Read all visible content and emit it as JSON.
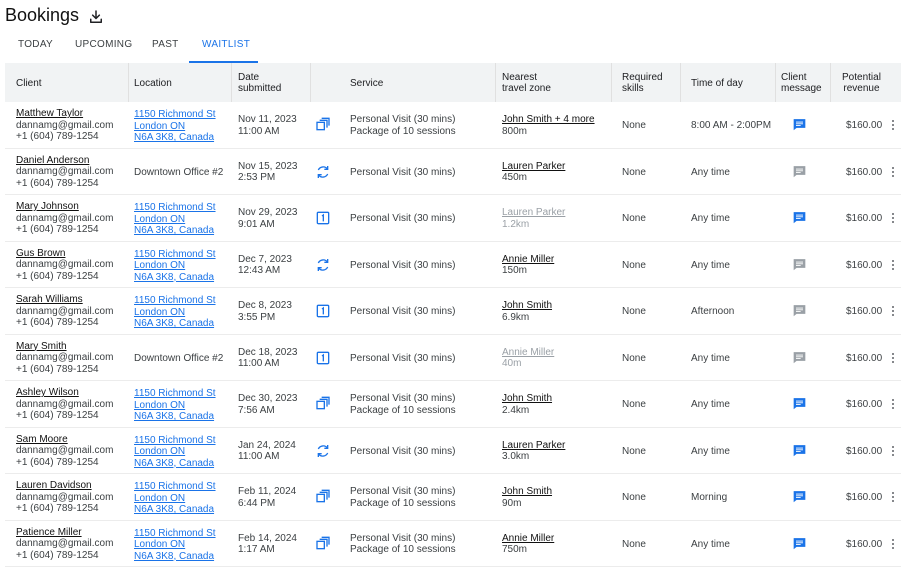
{
  "page": {
    "title": "Bookings",
    "download_icon": "download-icon"
  },
  "tabs": [
    {
      "label": "TODAY",
      "active": false
    },
    {
      "label": "UPCOMING",
      "active": false
    },
    {
      "label": "PAST",
      "active": false
    },
    {
      "label": "WAITLIST",
      "active": true
    }
  ],
  "columns": {
    "client": "Client",
    "location": "Location",
    "date1": "Date",
    "date2": "submitted",
    "service": "Service",
    "zone1": "Nearest",
    "zone2": "travel zone",
    "skills1": "Required",
    "skills2": "skills",
    "time": "Time of day",
    "msg1": "Client",
    "msg2": "message",
    "rev1": "Potential",
    "rev2": "revenue"
  },
  "colors": {
    "accent": "#1a73e8",
    "muted_icon": "#9aa0a6"
  },
  "rows": [
    {
      "name": "Matthew Taylor",
      "email": "dannamg@gmail.com",
      "phone": "+1 (604) 789-1254",
      "location": [
        "1150 Richmond St",
        "London ON",
        "N6A 3K8, Canada"
      ],
      "location_is_link": true,
      "date": "Nov 11, 2023",
      "time": "11:00 AM",
      "service_icon": "package-icon",
      "service": [
        "Personal Visit (30 mins)",
        "Package of 10 sessions"
      ],
      "zone_name": "John Smith + 4 more",
      "zone_dist": "800m",
      "zone_dim": false,
      "skills": "None",
      "time_of_day": "8:00 AM - 2:00PM",
      "message_active": true,
      "revenue": "$160.00"
    },
    {
      "name": "Daniel Anderson",
      "email": "dannamg@gmail.com",
      "phone": "+1 (604) 789-1254",
      "location": [
        "Downtown Office #2"
      ],
      "location_is_link": false,
      "date": "Nov 15, 2023",
      "time": "2:53 PM",
      "service_icon": "recurring-icon",
      "service": [
        "Personal Visit (30 mins)"
      ],
      "zone_name": "Lauren Parker",
      "zone_dist": "450m",
      "zone_dim": false,
      "skills": "None",
      "time_of_day": "Any time",
      "message_active": false,
      "revenue": "$160.00"
    },
    {
      "name": "Mary Johnson",
      "email": "dannamg@gmail.com",
      "phone": "+1 (604) 789-1254",
      "location": [
        "1150 Richmond St",
        "London ON",
        "N6A 3K8, Canada"
      ],
      "location_is_link": true,
      "date": "Nov 29, 2023",
      "time": "9:01 AM",
      "service_icon": "single-session-icon",
      "service": [
        "Personal Visit (30 mins)"
      ],
      "zone_name": "Lauren Parker",
      "zone_dist": "1.2km",
      "zone_dim": true,
      "skills": "None",
      "time_of_day": "Any time",
      "message_active": true,
      "revenue": "$160.00"
    },
    {
      "name": "Gus Brown",
      "email": "dannamg@gmail.com",
      "phone": "+1 (604) 789-1254",
      "location": [
        "1150 Richmond St",
        "London ON",
        "N6A 3K8, Canada"
      ],
      "location_is_link": true,
      "date": "Dec 7, 2023",
      "time": "12:43 AM",
      "service_icon": "recurring-icon",
      "service": [
        "Personal Visit (30 mins)"
      ],
      "zone_name": "Annie Miller",
      "zone_dist": "150m",
      "zone_dim": false,
      "skills": "None",
      "time_of_day": "Any time",
      "message_active": false,
      "revenue": "$160.00"
    },
    {
      "name": "Sarah Williams",
      "email": "dannamg@gmail.com",
      "phone": "+1 (604) 789-1254",
      "location": [
        "1150 Richmond St",
        "London ON",
        "N6A 3K8, Canada"
      ],
      "location_is_link": true,
      "date": "Dec 8, 2023",
      "time": "3:55 PM",
      "service_icon": "single-session-icon",
      "service": [
        "Personal Visit (30 mins)"
      ],
      "zone_name": "John Smith",
      "zone_dist": "6.9km",
      "zone_dim": false,
      "skills": "None",
      "time_of_day": "Afternoon",
      "message_active": false,
      "revenue": "$160.00"
    },
    {
      "name": "Mary Smith",
      "email": "dannamg@gmail.com",
      "phone": "+1 (604) 789-1254",
      "location": [
        "Downtown Office #2"
      ],
      "location_is_link": false,
      "date": "Dec 18, 2023",
      "time": "11:00 AM",
      "service_icon": "single-session-icon",
      "service": [
        "Personal Visit (30 mins)"
      ],
      "zone_name": "Annie Miller",
      "zone_dist": "40m",
      "zone_dim": true,
      "skills": "None",
      "time_of_day": "Any time",
      "message_active": false,
      "revenue": "$160.00"
    },
    {
      "name": "Ashley Wilson",
      "email": "dannamg@gmail.com",
      "phone": "+1 (604) 789-1254",
      "location": [
        "1150 Richmond St",
        "London ON",
        "N6A 3K8, Canada"
      ],
      "location_is_link": true,
      "date": "Dec 30, 2023",
      "time": "7:56 AM",
      "service_icon": "package-icon",
      "service": [
        "Personal Visit (30 mins)",
        "Package of 10 sessions"
      ],
      "zone_name": "John Smith",
      "zone_dist": "2.4km",
      "zone_dim": false,
      "skills": "None",
      "time_of_day": "Any time",
      "message_active": true,
      "revenue": "$160.00"
    },
    {
      "name": "Sam Moore",
      "email": "dannamg@gmail.com",
      "phone": "+1 (604) 789-1254",
      "location": [
        "1150 Richmond St",
        "London ON",
        "N6A 3K8, Canada"
      ],
      "location_is_link": true,
      "date": "Jan 24, 2024",
      "time": "11:00 AM",
      "service_icon": "recurring-icon",
      "service": [
        "Personal Visit (30 mins)"
      ],
      "zone_name": "Lauren Parker",
      "zone_dist": "3.0km",
      "zone_dim": false,
      "skills": "None",
      "time_of_day": "Any time",
      "message_active": true,
      "revenue": "$160.00"
    },
    {
      "name": "Lauren Davidson",
      "email": "dannamg@gmail.com",
      "phone": "+1 (604) 789-1254",
      "location": [
        "1150 Richmond St",
        "London ON",
        "N6A 3K8, Canada"
      ],
      "location_is_link": true,
      "date": "Feb 11, 2024",
      "time": "6:44 PM",
      "service_icon": "package-icon",
      "service": [
        "Personal Visit (30 mins)",
        "Package of 10 sessions"
      ],
      "zone_name": "John Smith",
      "zone_dist": "90m",
      "zone_dim": false,
      "skills": "None",
      "time_of_day": "Morning",
      "message_active": true,
      "revenue": "$160.00"
    },
    {
      "name": "Patience Miller",
      "email": "dannamg@gmail.com",
      "phone": "+1 (604) 789-1254",
      "location": [
        "1150 Richmond St",
        "London ON",
        "N6A 3K8, Canada"
      ],
      "location_is_link": true,
      "date": "Feb 14, 2024",
      "time": "1:17 AM",
      "service_icon": "package-icon",
      "service": [
        "Personal Visit (30 mins)",
        "Package of 10 sessions"
      ],
      "zone_name": "Annie Miller",
      "zone_dist": "750m",
      "zone_dim": false,
      "skills": "None",
      "time_of_day": "Any time",
      "message_active": true,
      "revenue": "$160.00"
    }
  ]
}
